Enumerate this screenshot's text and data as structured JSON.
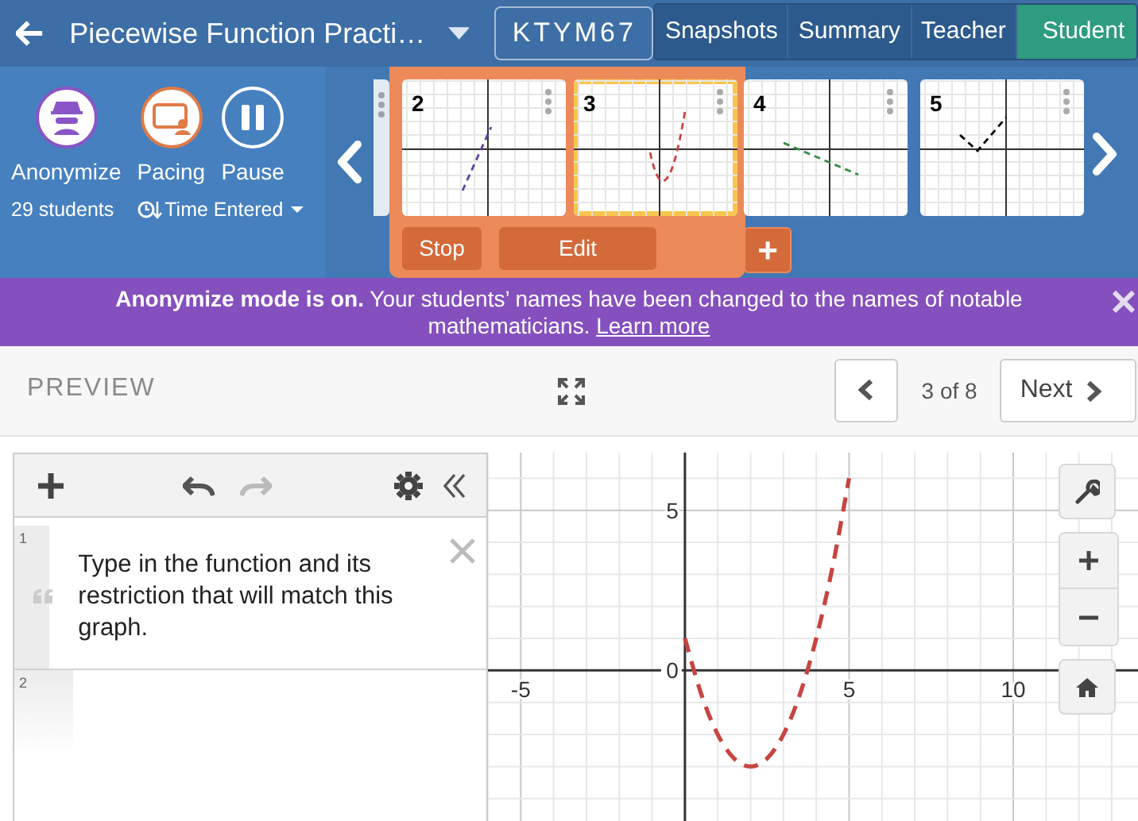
{
  "header": {
    "title": "Piecewise Function Practi…",
    "code": "KTYM67",
    "tabs": [
      {
        "label": "Snapshots",
        "selected": false
      },
      {
        "label": "Summary",
        "selected": false
      },
      {
        "label": "Teacher",
        "selected": false
      },
      {
        "label": "Student",
        "selected": true
      }
    ]
  },
  "controls": [
    {
      "label": "Anonymize",
      "kind": "anonymize",
      "on": true
    },
    {
      "label": "Pacing",
      "kind": "pacing",
      "on": true
    },
    {
      "label": "Pause",
      "kind": "pause",
      "on": false
    }
  ],
  "student_count": "29 students",
  "sort": "Time Entered",
  "screens": [
    {
      "number": "2",
      "kind": "line",
      "color": "#6042a6",
      "selected": false
    },
    {
      "number": "3",
      "kind": "parabola",
      "color": "#c74440",
      "selected": true
    },
    {
      "number": "4",
      "kind": "segment",
      "color": "#388c46",
      "selected": false
    },
    {
      "number": "5",
      "kind": "vee",
      "color": "#000000",
      "selected": false
    }
  ],
  "screen_actions": [
    "Stop",
    "Edit"
  ],
  "add_button": "+",
  "banner": {
    "text": "**Anonymize mode is on.** Your students’ names have been changed to the names of notable mathematicians.",
    "link": "Learn more"
  },
  "preview": {
    "label": "PREVIEW",
    "position": "3 of 8",
    "next": "Next"
  },
  "toolbar": {
    "redo_disabled": true
  },
  "expressions": [
    {
      "number": "1",
      "kind": "note",
      "text": "Type in the function and its restriction that will match this graph."
    },
    {
      "number": "2",
      "kind": "empty"
    }
  ],
  "graph": {
    "chart_data": {
      "type": "line",
      "x": [
        0,
        0.5,
        1,
        1.5,
        2,
        2.5,
        3,
        3.5,
        4,
        4.5,
        5
      ],
      "grid": true,
      "series": [
        {
          "color": "#c74440",
          "line_style": "dashed",
          "values": [
            1,
            -0.75,
            -2,
            -2.75,
            -3,
            -2.75,
            -2,
            -0.75,
            1,
            3.25,
            6
          ]
        }
      ],
      "xticks": [
        -5,
        5,
        10
      ],
      "yticks": [
        {
          "value": 0,
          "label": "0"
        },
        5
      ],
      "xlim": [
        -6,
        13.8
      ],
      "ylim": [
        -4.7,
        6.8
      ]
    }
  }
}
